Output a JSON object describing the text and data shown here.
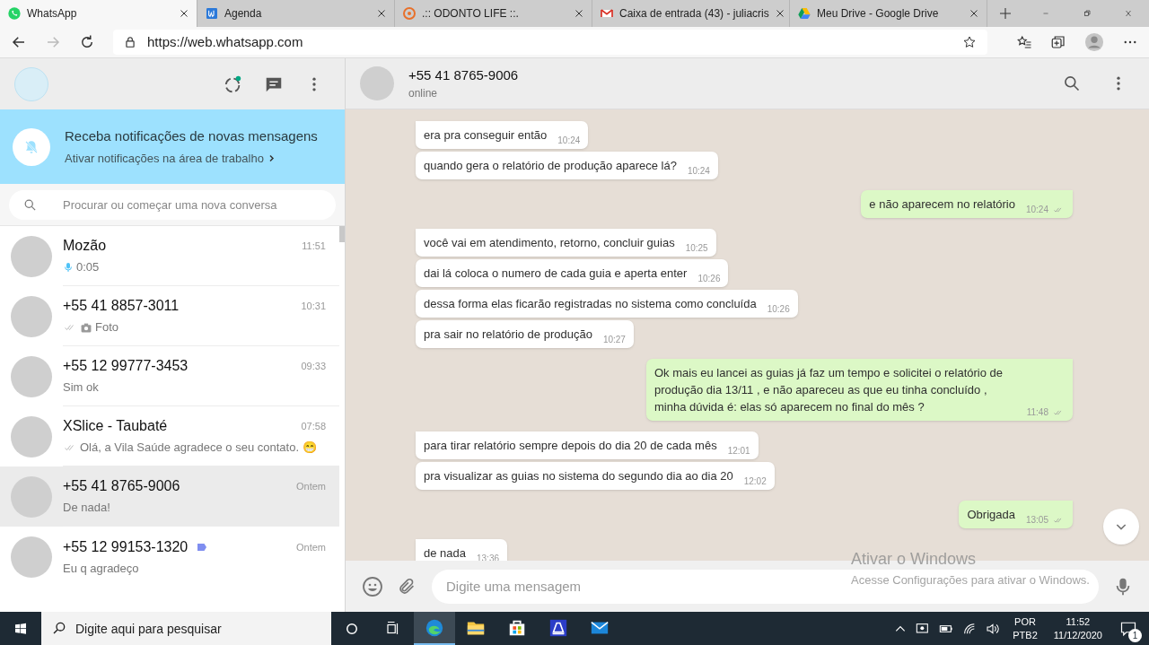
{
  "browser": {
    "tabs": [
      {
        "kind": "whatsapp",
        "title": "WhatsApp",
        "selected": true
      },
      {
        "kind": "agenda",
        "title": "Agenda",
        "selected": false
      },
      {
        "kind": "odonto",
        "title": ".:: ODONTO LIFE ::.",
        "selected": false
      },
      {
        "kind": "gmail",
        "title": "Caixa de entrada (43) - juliacris",
        "selected": false
      },
      {
        "kind": "drive",
        "title": "Meu Drive - Google Drive",
        "selected": false
      }
    ],
    "address": "https://web.whatsapp.com"
  },
  "sidebar": {
    "notification": {
      "title": "Receba notificações de novas mensagens",
      "link": "Ativar notificações na área de trabalho"
    },
    "search": {
      "placeholder": "Procurar ou começar uma nova conversa"
    },
    "chats": [
      {
        "kind": "voice",
        "name": "Mozão",
        "time": "11:51",
        "preview": "0:05",
        "selected": false
      },
      {
        "kind": "photo",
        "name": "+55 41 8857-3011",
        "time": "10:31",
        "preview": "Foto",
        "ticks": true,
        "selected": false
      },
      {
        "kind": "text",
        "name": "+55 12 99777-3453",
        "time": "09:33",
        "preview": "Sim ok",
        "selected": false
      },
      {
        "kind": "text",
        "name": "XSlice - Taubaté",
        "time": "07:58",
        "preview": "Olá, a Vila Saúde agradece o seu contato. 😁",
        "ticks": true,
        "selected": false
      },
      {
        "kind": "text",
        "name": "+55 41 8765-9006",
        "time": "Ontem",
        "preview": "De nada!",
        "selected": true
      },
      {
        "kind": "text",
        "name": "+55 12 99153-1320",
        "time": "Ontem",
        "preview": "Eu q agradeço",
        "labeled": true,
        "selected": false
      }
    ]
  },
  "chat": {
    "name": "+55 41 8765-9006",
    "status": "online",
    "messages": [
      {
        "kind": "incoming",
        "group_start": true,
        "text": "era pra conseguir então",
        "time": "10:24"
      },
      {
        "kind": "incoming",
        "group_start": false,
        "text": "quando gera o relatório de produção aparece lá?",
        "time": "10:24"
      },
      {
        "kind": "outgoing",
        "group_start": true,
        "text": "e não aparecem no relatório",
        "time": "10:24"
      },
      {
        "kind": "incoming",
        "group_start": true,
        "text": "você vai em atendimento, retorno, concluir guias",
        "time": "10:25"
      },
      {
        "kind": "incoming",
        "group_start": false,
        "text": "dai lá coloca o numero de cada guia e aperta enter",
        "time": "10:26"
      },
      {
        "kind": "incoming",
        "group_start": false,
        "text": "dessa forma elas ficarão registradas no sistema como concluída",
        "time": "10:26"
      },
      {
        "kind": "incoming",
        "group_start": false,
        "text": "pra sair no relatório de produção",
        "time": "10:27"
      },
      {
        "kind": "outgoing",
        "group_start": true,
        "text": "Ok mais eu lancei as guias já faz um tempo e solicitei o relatório de produção dia 13/11 , e não apareceu as que eu tinha concluído , minha dúvida é: elas só aparecem no final do mês ?",
        "time": "11:48"
      },
      {
        "kind": "incoming",
        "group_start": true,
        "text": "para tirar relatório sempre depois do dia 20 de cada mês",
        "time": "12:01"
      },
      {
        "kind": "incoming",
        "group_start": false,
        "text": "pra visualizar as guias no sistema do segundo dia ao dia 20",
        "time": "12:02"
      },
      {
        "kind": "outgoing",
        "group_start": true,
        "text": "Obrigada",
        "time": "13:05"
      },
      {
        "kind": "incoming",
        "group_start": true,
        "text": "de nada",
        "time": "13:36"
      }
    ],
    "composer": {
      "placeholder": "Digite uma mensagem"
    }
  },
  "activation_notice": {
    "title": "Ativar o Windows",
    "text": "Acesse Configurações para ativar o Windows."
  },
  "taskbar": {
    "search": {
      "placeholder": "Digite aqui para pesquisar"
    },
    "apps": [
      {
        "kind": "edge",
        "active": true
      },
      {
        "kind": "folder",
        "active": false
      },
      {
        "kind": "store",
        "active": false
      },
      {
        "kind": "scanner",
        "active": false
      },
      {
        "kind": "mail",
        "active": false
      }
    ],
    "language": "POR",
    "layout": "PTB2",
    "time": "11:52",
    "date": "11/12/2020",
    "notifications": "1"
  }
}
